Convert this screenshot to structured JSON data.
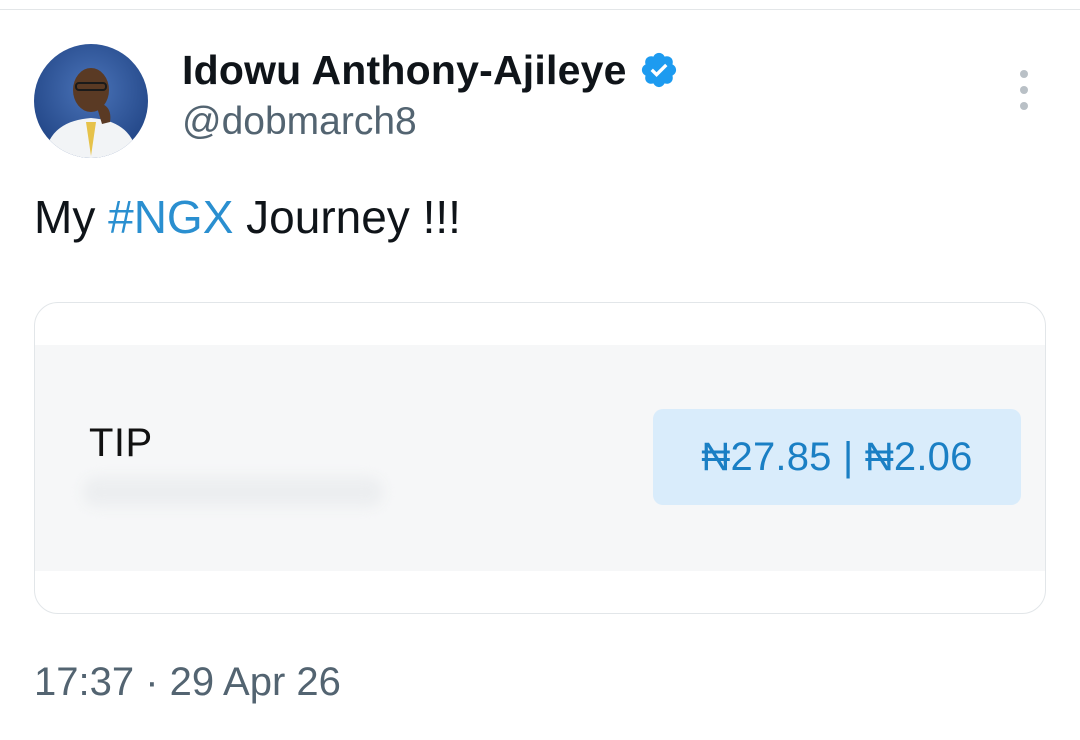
{
  "tweet": {
    "author": {
      "display_name": "Idowu Anthony-Ajileye",
      "handle": "@dobmarch8",
      "verified": true,
      "avatar_icon": "profile-photo"
    },
    "text_prefix": "My ",
    "hashtag": "#NGX",
    "text_suffix": " Journey !!!",
    "media": {
      "label": "TIP",
      "price": "₦27.85 | ₦2.06"
    },
    "timestamp": "17:37 · 29 Apr 26"
  },
  "colors": {
    "accent": "#1d9bf0",
    "verified_badge": "#1d9bf0",
    "secondary_text": "#536471",
    "price_pill_bg": "#d9ecfb",
    "price_text": "#1a7fc4"
  },
  "icons": {
    "verified": "verified-badge-icon",
    "more": "more-options-icon"
  }
}
